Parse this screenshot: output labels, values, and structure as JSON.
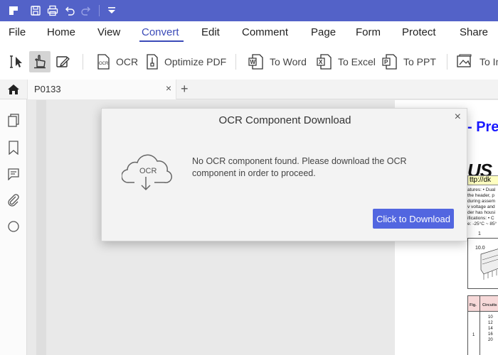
{
  "menu": {
    "items": [
      "File",
      "Home",
      "View",
      "Convert",
      "Edit",
      "Comment",
      "Page",
      "Form",
      "Protect",
      "Share"
    ],
    "active": "Convert"
  },
  "toolbar": {
    "ocr_label": "OCR",
    "optimize_label": "Optimize PDF",
    "to_word_label": "To Word",
    "to_excel_label": "To Excel",
    "to_ppt_label": "To PPT",
    "to_image_label": "To In"
  },
  "tabs": {
    "doc_name": "P0133",
    "close_glyph": "×",
    "add_glyph": "+"
  },
  "dialog": {
    "title": "OCR Component Download",
    "close_glyph": "×",
    "icon_text": "OCR",
    "message": "No OCR component found. Please download the OCR component in order to proceed.",
    "button_label": "Click to Download"
  },
  "document": {
    "heading": "- Pre",
    "brand": "US",
    "url_fragment": "ttp://dk",
    "spec_lines": [
      "atures: • Dual",
      "the header, p",
      "during assem",
      "v voltage and",
      "der has housi",
      "ifications: • C",
      "e: -25°C ~ 85°"
    ],
    "fig_label": "1",
    "dim_label": "10.0",
    "table_headers": [
      "Fig.",
      "Circuits",
      "D"
    ],
    "table_circuits": [
      "10",
      "12",
      "14",
      "16",
      "20"
    ],
    "table_fig": "1"
  },
  "colors": {
    "title_bar": "#5362c8",
    "accent": "#3b4bb8",
    "button": "#5266e0",
    "heading_blue": "#1a1aff"
  }
}
